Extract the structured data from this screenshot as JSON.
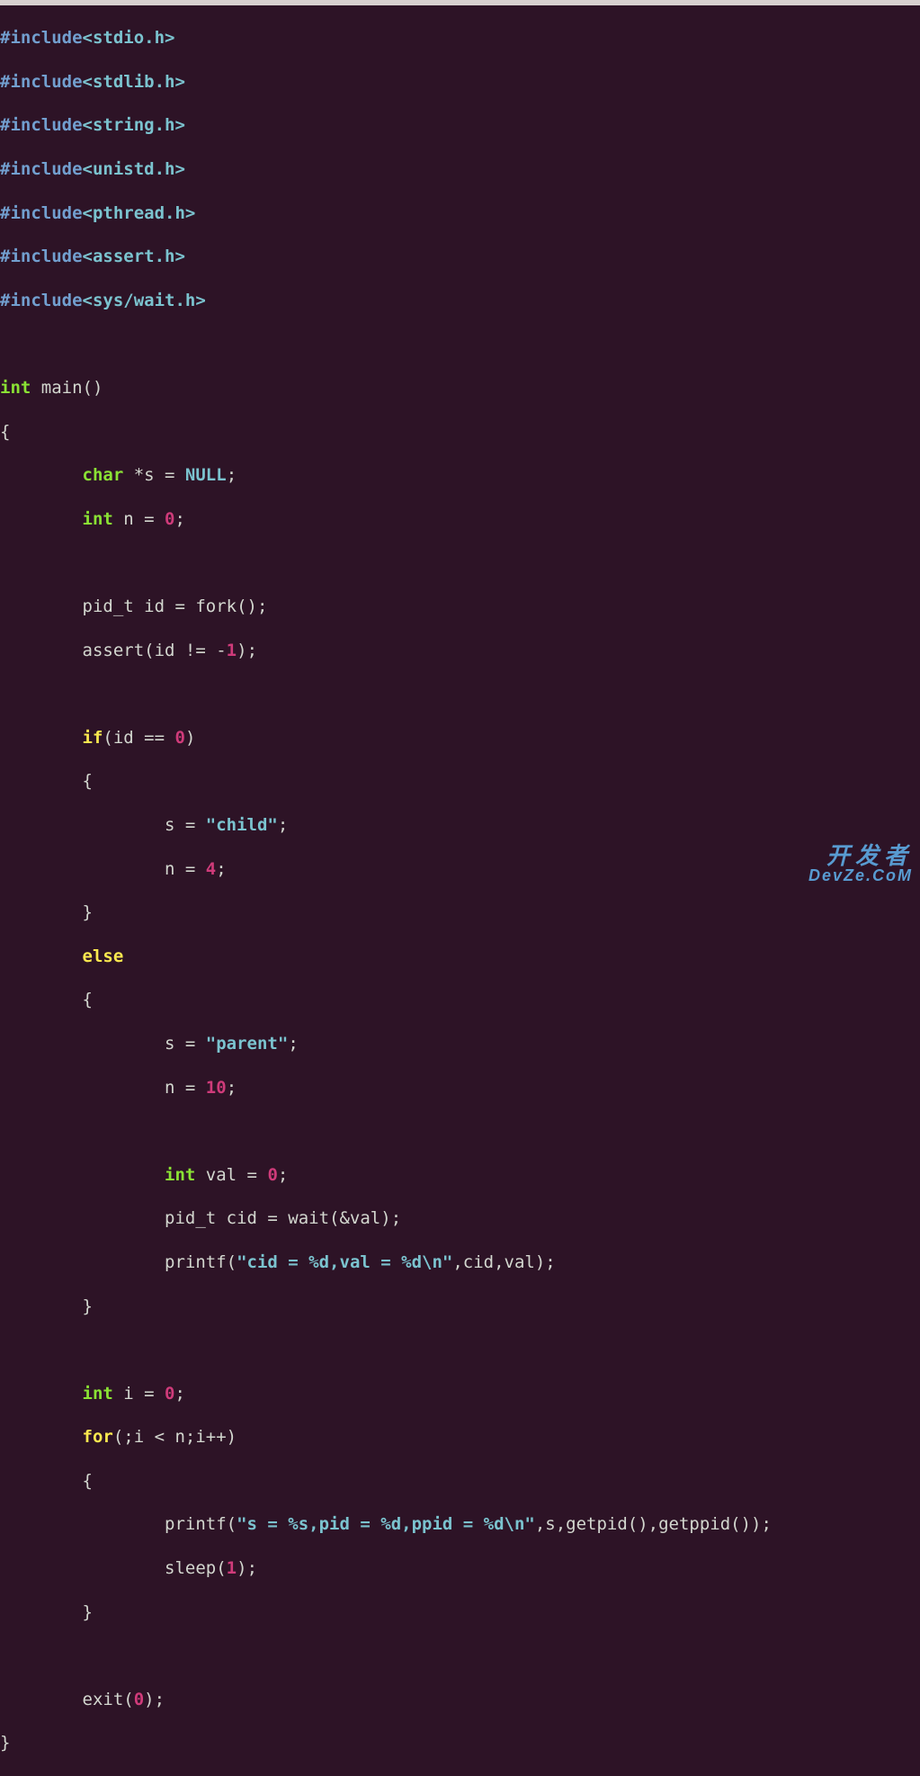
{
  "includes": {
    "directive": "#include",
    "headers": [
      "<stdio.h>",
      "<stdlib.h>",
      "<string.h>",
      "<unistd.h>",
      "<pthread.h>",
      "<assert.h>",
      "<sys/wait.h>"
    ]
  },
  "decl": {
    "ret": "int",
    "main": " main()",
    "ob": "{",
    "cb": "}"
  },
  "l_char": "char",
  "l_sNull": " *s = ",
  "l_NULL": "NULL",
  "l_semi": ";",
  "l_int": "int",
  "l_n0": " n = ",
  "l_zero": "0",
  "l_pidt": "pid_t id = fork();",
  "l_assert": "assert(id != -",
  "l_one": "1",
  "l_assert_end": ");",
  "kw_if": "if",
  "if_cond": "(id == ",
  "if_cond_end": ")",
  "brace_o": "{",
  "brace_c": "}",
  "s_eq": "s = ",
  "child_str": "\"child\"",
  "n_eq": "n = ",
  "four": "4",
  "kw_else": "else",
  "parent_str": "\"parent\"",
  "ten": "10",
  "val_decl": " val = ",
  "pid_cid": "pid_t cid = wait(&val);",
  "printf1_a": "printf(",
  "printf1_str": "\"cid = %d,val = %d\\n\"",
  "printf1_b": ",cid,val);",
  "i_decl": " i = ",
  "kw_for": "for",
  "for_cond": "(;i < n;i++)",
  "printf2_a": "printf(",
  "printf2_str": "\"s = %s,pid = %d,ppid = %d\\n\"",
  "printf2_b": ",s,getpid(),getppid());",
  "sleep_a": "sleep(",
  "sleep_b": ");",
  "exit_a": "exit(",
  "exit_b": ");",
  "wm1": "开发者",
  "wm2": "DevZe.CoM"
}
